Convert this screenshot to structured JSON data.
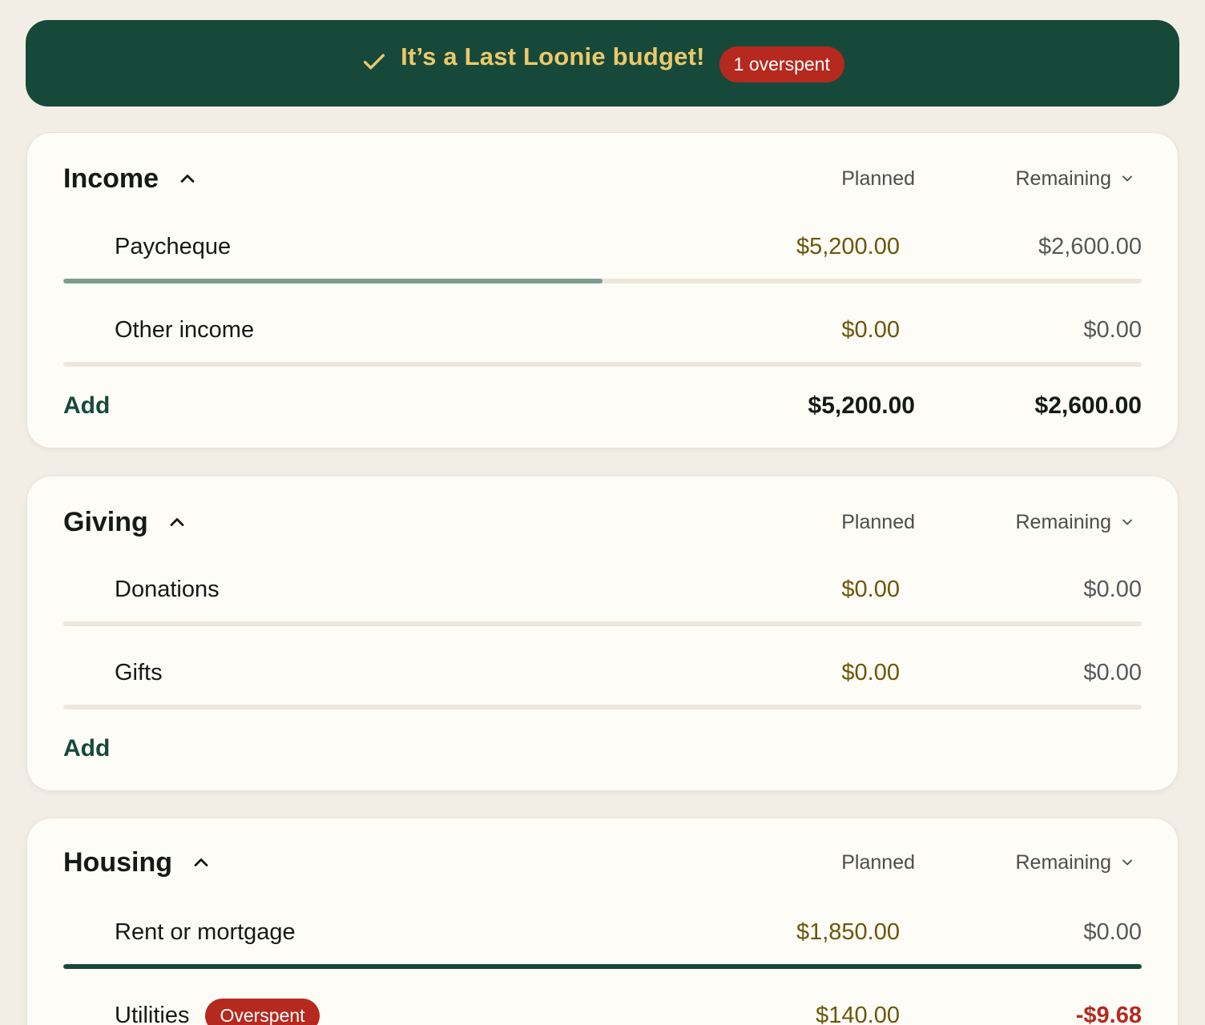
{
  "banner": {
    "title": "It’s a Last Loonie budget!",
    "badge": "1 overspent",
    "icon": "check-icon"
  },
  "columns": {
    "planned": "Planned",
    "remaining": "Remaining"
  },
  "groups": [
    {
      "title": "Income",
      "items": [
        {
          "label": "Paycheque",
          "planned": "$5,200.00",
          "remaining": "$2,600.00",
          "progress": 0.5
        },
        {
          "label": "Other income",
          "planned": "$0.00",
          "remaining": "$0.00",
          "progress": 0
        }
      ],
      "add_label": "Add",
      "total_planned": "$5,200.00",
      "total_remaining": "$2,600.00"
    },
    {
      "title": "Giving",
      "items": [
        {
          "label": "Donations",
          "planned": "$0.00",
          "remaining": "$0.00",
          "progress": 0
        },
        {
          "label": "Gifts",
          "planned": "$0.00",
          "remaining": "$0.00",
          "progress": 0
        }
      ],
      "add_label": "Add"
    },
    {
      "title": "Housing",
      "items": [
        {
          "label": "Rent or mortgage",
          "planned": "$1,850.00",
          "remaining": "$0.00",
          "progress": 1
        },
        {
          "label": "Utilities",
          "badge": "Overspent",
          "planned": "$140.00",
          "remaining": "-$9.68"
        }
      ]
    }
  ],
  "colors": {
    "brand": "#17493b",
    "accent_gold": "#ebc96a",
    "danger": "#b5291f",
    "progress_partial": "#7c9c8e",
    "progress_full": "#17493b"
  }
}
